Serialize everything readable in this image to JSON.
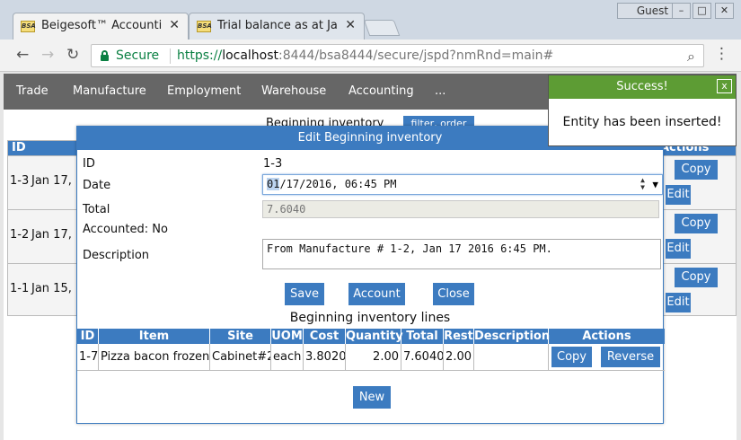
{
  "browser": {
    "profile": "Guest",
    "tabs": [
      {
        "icon": "BSA",
        "title": "Beigesoft™ Accounti"
      },
      {
        "icon": "BSA",
        "title": "Trial balance as at Ja"
      }
    ],
    "secure_label": "Secure",
    "url": {
      "scheme": "https://",
      "host": "localhost",
      "rest": ":8444/bsa8444/secure/jspd?nmRnd=main#"
    },
    "window_controls": [
      "–",
      "□",
      "✕"
    ]
  },
  "nav": {
    "items": [
      "Trade",
      "Manufacture",
      "Employment",
      "Warehouse",
      "Accounting",
      "..."
    ]
  },
  "background": {
    "title": "Beginning inventory",
    "filter_label": "filter, order",
    "headers": {
      "id": "ID",
      "actions": "Actions"
    },
    "rows": [
      {
        "id": "1-3",
        "date": "Jan 17,"
      },
      {
        "id": "1-2",
        "date": "Jan 17,"
      },
      {
        "id": "1-1",
        "date": "Jan 15,"
      }
    ],
    "copy_label": "Copy",
    "edit_label": "Edit"
  },
  "toast": {
    "title": "Success!",
    "close": "x",
    "message": "Entity has been inserted!"
  },
  "dialog": {
    "title": "Edit Beginning inventory",
    "close": "x",
    "fields": {
      "id_label": "ID",
      "id_value": "1-3",
      "date_label": "Date",
      "date_selected": "01",
      "date_rest": "/17/2016, 06:45 PM",
      "total_label": "Total",
      "total_value": "7.6040",
      "accounted_label": "Accounted: No",
      "description_label": "Description",
      "description_value": "From Manufacture # 1-2, Jan 17 2016 6:45 PM."
    },
    "buttons": {
      "save": "Save",
      "account": "Account",
      "close": "Close"
    },
    "lines": {
      "title": "Beginning inventory lines",
      "columns": [
        "ID",
        "Item",
        "Site",
        "UOM",
        "Cost",
        "Quantity",
        "Total",
        "Rest",
        "Description",
        "Actions"
      ],
      "rows": [
        {
          "id": "1-7",
          "item": "Pizza bacon frozen",
          "site": "Cabinet#2",
          "uom": "each",
          "cost": "3.8020",
          "quantity": "2.00",
          "total": "7.6040",
          "rest": "2.00",
          "description": ""
        }
      ],
      "copy_label": "Copy",
      "reverse_label": "Reverse",
      "new_label": "New"
    }
  }
}
